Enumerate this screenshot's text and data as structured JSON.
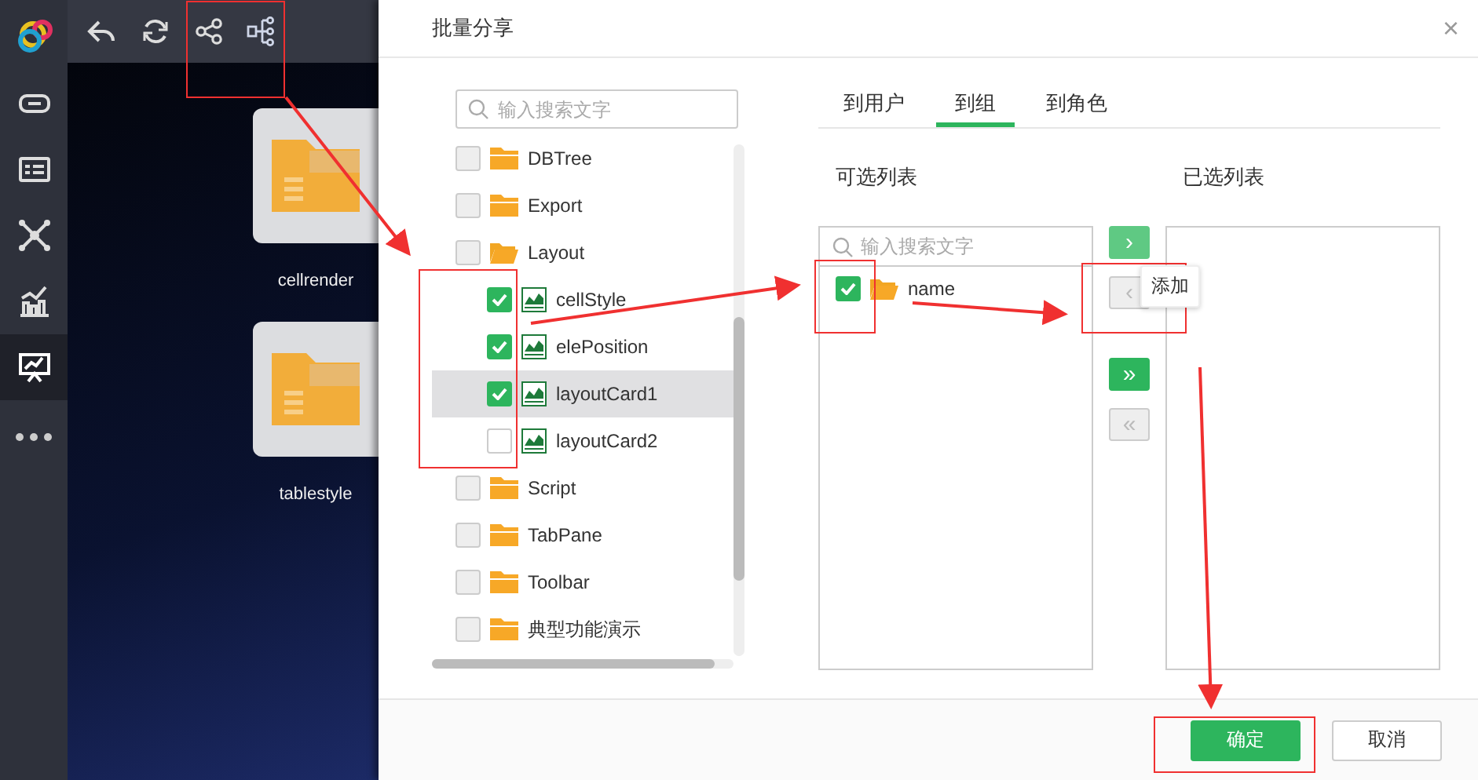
{
  "sidebar": {
    "items": [
      {
        "selected": false
      },
      {
        "selected": false
      },
      {
        "selected": false
      },
      {
        "selected": false
      },
      {
        "selected": false
      },
      {
        "selected": true
      },
      {
        "selected": false
      }
    ]
  },
  "cards": [
    {
      "label": "cellrender"
    },
    {
      "label": "tablestyle"
    }
  ],
  "dialog": {
    "title": "批量分享",
    "close": "×",
    "tree": {
      "search_placeholder": "输入搜索文字",
      "items": [
        {
          "kind": "folder",
          "label": "DBTree",
          "checked": false,
          "expanded": false,
          "selected": false
        },
        {
          "kind": "folder",
          "label": "Export",
          "checked": false,
          "expanded": false,
          "selected": false
        },
        {
          "kind": "folder",
          "label": "Layout",
          "checked": false,
          "expanded": true,
          "selected": false,
          "children": [
            {
              "kind": "report",
              "label": "cellStyle",
              "checked": true,
              "selected": false
            },
            {
              "kind": "report",
              "label": "elePosition",
              "checked": true,
              "selected": false
            },
            {
              "kind": "report",
              "label": "layoutCard1",
              "checked": true,
              "selected": true
            },
            {
              "kind": "report",
              "label": "layoutCard2",
              "checked": false,
              "selected": false
            }
          ]
        },
        {
          "kind": "folder",
          "label": "Script",
          "checked": false,
          "expanded": false,
          "selected": false
        },
        {
          "kind": "folder",
          "label": "TabPane",
          "checked": false,
          "expanded": false,
          "selected": false
        },
        {
          "kind": "folder",
          "label": "Toolbar",
          "checked": false,
          "expanded": false,
          "selected": false
        },
        {
          "kind": "folder",
          "label": "典型功能演示",
          "checked": false,
          "expanded": false,
          "selected": false
        }
      ]
    },
    "tabs": [
      {
        "label": "到用户",
        "selected": false
      },
      {
        "label": "到组",
        "selected": true
      },
      {
        "label": "到角色",
        "selected": false
      }
    ],
    "available": {
      "title": "可选列表",
      "placeholder": "输入搜索文字",
      "items": [
        {
          "label": "name",
          "checked": true
        }
      ]
    },
    "transfer_buttons": [
      {
        "label": "›",
        "disabled": false,
        "hovered": true
      },
      {
        "label": "‹",
        "disabled": true,
        "hovered": false
      },
      {
        "label": "»",
        "disabled": false,
        "hovered": false
      },
      {
        "label": "«",
        "disabled": true,
        "hovered": false
      }
    ],
    "tooltip": "添加",
    "selected_list": {
      "title": "已选列表"
    },
    "buttons": [
      {
        "kind": "primary",
        "label": "确定"
      },
      {
        "kind": "secondary",
        "label": "取消"
      }
    ]
  }
}
